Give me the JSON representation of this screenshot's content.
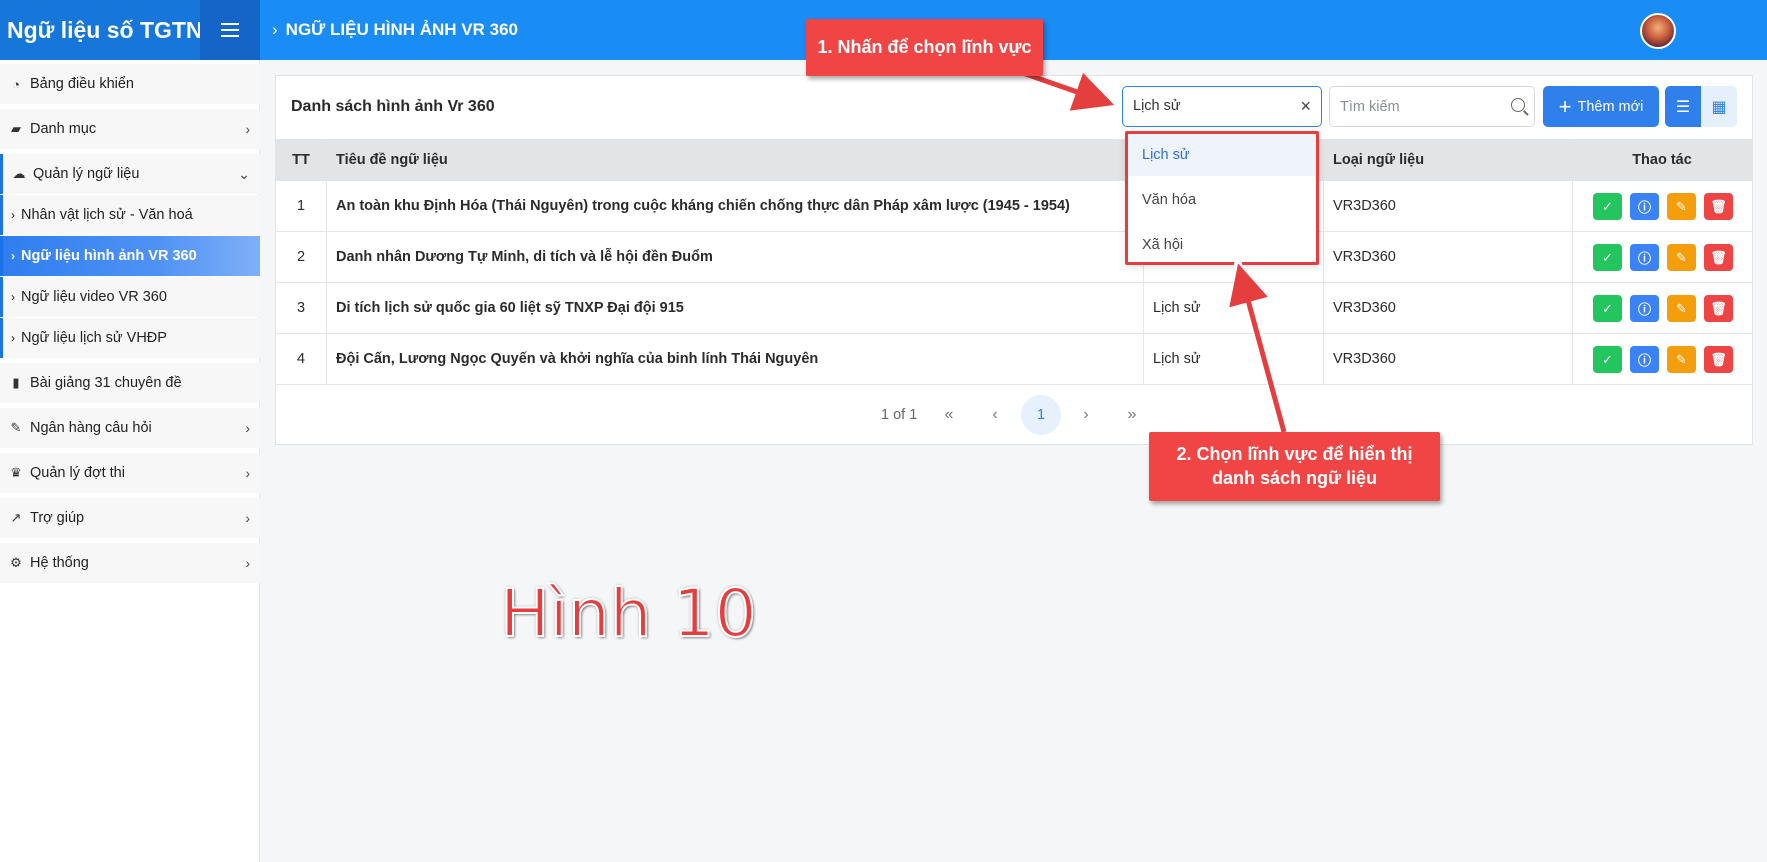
{
  "app": {
    "title": "Ngữ liệu số TGTN"
  },
  "header": {
    "breadcrumb": "NGỮ LIỆU HÌNH ẢNH VR 360"
  },
  "sidebar": {
    "items": [
      {
        "label": "Bảng điều khiển",
        "icon": "gauge-icon"
      },
      {
        "label": "Danh mục",
        "icon": "folder-open-icon"
      },
      {
        "label": "Quản lý ngữ liệu",
        "icon": "cloud-icon"
      },
      {
        "label": "Bài giảng 31 chuyên đề",
        "icon": "book-icon"
      },
      {
        "label": "Ngân hàng câu hỏi",
        "icon": "edit-icon"
      },
      {
        "label": "Quản lý đợt thi",
        "icon": "trophy-icon"
      },
      {
        "label": "Trợ giúp",
        "icon": "chart-line-icon"
      },
      {
        "label": "Hệ thống",
        "icon": "cogs-icon"
      }
    ],
    "sub_items": [
      {
        "label": "Nhân vật lịch sử - Văn hoá"
      },
      {
        "label": "Ngữ liệu hình ảnh VR 360"
      },
      {
        "label": "Ngữ liệu video VR 360"
      },
      {
        "label": "Ngữ liệu lịch sử VHĐP"
      }
    ]
  },
  "card": {
    "title": "Danh sách hình ảnh Vr 360",
    "field_select": {
      "value": "Lịch sử"
    },
    "search": {
      "placeholder": "Tìm kiếm"
    },
    "add_button": "Thêm mới"
  },
  "dropdown": {
    "options": [
      "Lịch sử",
      "Văn hóa",
      "Xã hội"
    ],
    "selected": "Lịch sử"
  },
  "table": {
    "headers": {
      "tt": "TT",
      "title": "Tiêu đề ngữ liệu",
      "type": "Loại ngữ liệu",
      "actions": "Thao tác"
    },
    "rows": [
      {
        "tt": "1",
        "title": "An toàn khu Định Hóa (Thái Nguyên) trong cuộc kháng chiến chống thực dân Pháp xâm lược (1945 - 1954)",
        "field": "",
        "type": "VR3D360"
      },
      {
        "tt": "2",
        "title": "Danh nhân Dương Tự Minh, di tích và lễ hội đền Đuổm",
        "field": "",
        "type": "VR3D360"
      },
      {
        "tt": "3",
        "title": "Di tích lịch sử quốc gia 60 liệt sỹ TNXP Đại đội 915",
        "field": "Lịch sử",
        "type": "VR3D360"
      },
      {
        "tt": "4",
        "title": "Đội Cấn, Lương Ngọc Quyến và khởi nghĩa của binh lính Thái Nguyên",
        "field": "Lịch sử",
        "type": "VR3D360"
      }
    ]
  },
  "pagination": {
    "summary": "1 of 1",
    "current": "1"
  },
  "annotations": {
    "step1": "1. Nhấn để chọn lĩnh vực",
    "step2_line1": "2. Chọn lĩnh vực để hiển thị",
    "step2_line2": "danh sách ngữ liệu",
    "figure": "Hình 10"
  },
  "colors": {
    "header": "#1a8cf5",
    "brand_bg": "#1676d9",
    "accent": "#2f80ed",
    "annotation": "#f14545"
  }
}
